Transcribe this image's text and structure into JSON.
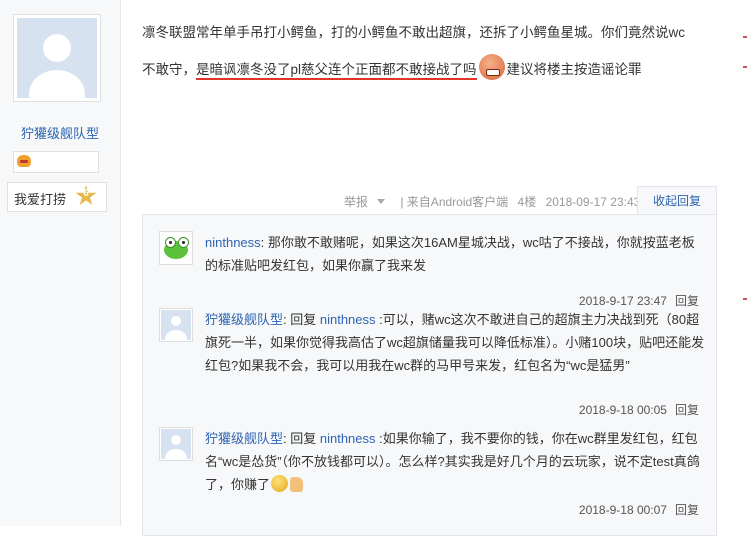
{
  "user": {
    "name": "狞獾级舰队型",
    "fan_label": "我爱打捞",
    "level": "6"
  },
  "post": {
    "line1": "凛冬联盟常年单手吊打小鳄鱼，打的小鳄鱼不敢出超旗，还拆了小鳄鱼星城。你们竟然说wc",
    "line2_start": "不敢守，",
    "line2_underlined": "是暗讽凛冬没了pl慈父连个正面都不敢接战了吗",
    "line2_end": "建议将楼主按造谣论罪"
  },
  "meta": {
    "report": "举报",
    "source": "| 来自Android客户端",
    "floor": "4楼",
    "time": "2018-09-17 23:43",
    "fold_reply": "收起回复"
  },
  "replies": [
    {
      "name": "ninthness",
      "text": ": 那你敢不敢赌呢，如果这次16AM星城决战，wc咕了不接战，你就按蓝老板的标准贴吧发红包，如果你赢了我来发",
      "time": "2018-9-17 23:47",
      "reply_label": "回复"
    },
    {
      "name": "狞獾级舰队型",
      "reply_word": ": 回复 ",
      "target": "ninthness",
      "text": " :可以，赌wc这次不敢进自己的超旗主力决战到死（80超旗死一半，如果你觉得我高估了wc超旗储量我可以降低标准）。小赌100块，贴吧还能发红包?如果我不会，我可以用我在wc群的马甲号来发，红包名为“wc是猛男”",
      "time": "2018-9-18 00:05",
      "reply_label": "回复"
    },
    {
      "name": "狞獾级舰队型",
      "reply_word": ": 回复 ",
      "target": "ninthness",
      "text": " :如果你输了，我不要你的钱，你在wc群里发红包，红包名“wc是怂货”（你不放钱都可以）。怎么样?其实我是好几个月的云玩家，说不定test真鸽了，你赚了",
      "time": "2018-9-18 00:07",
      "reply_label": "回复"
    }
  ]
}
